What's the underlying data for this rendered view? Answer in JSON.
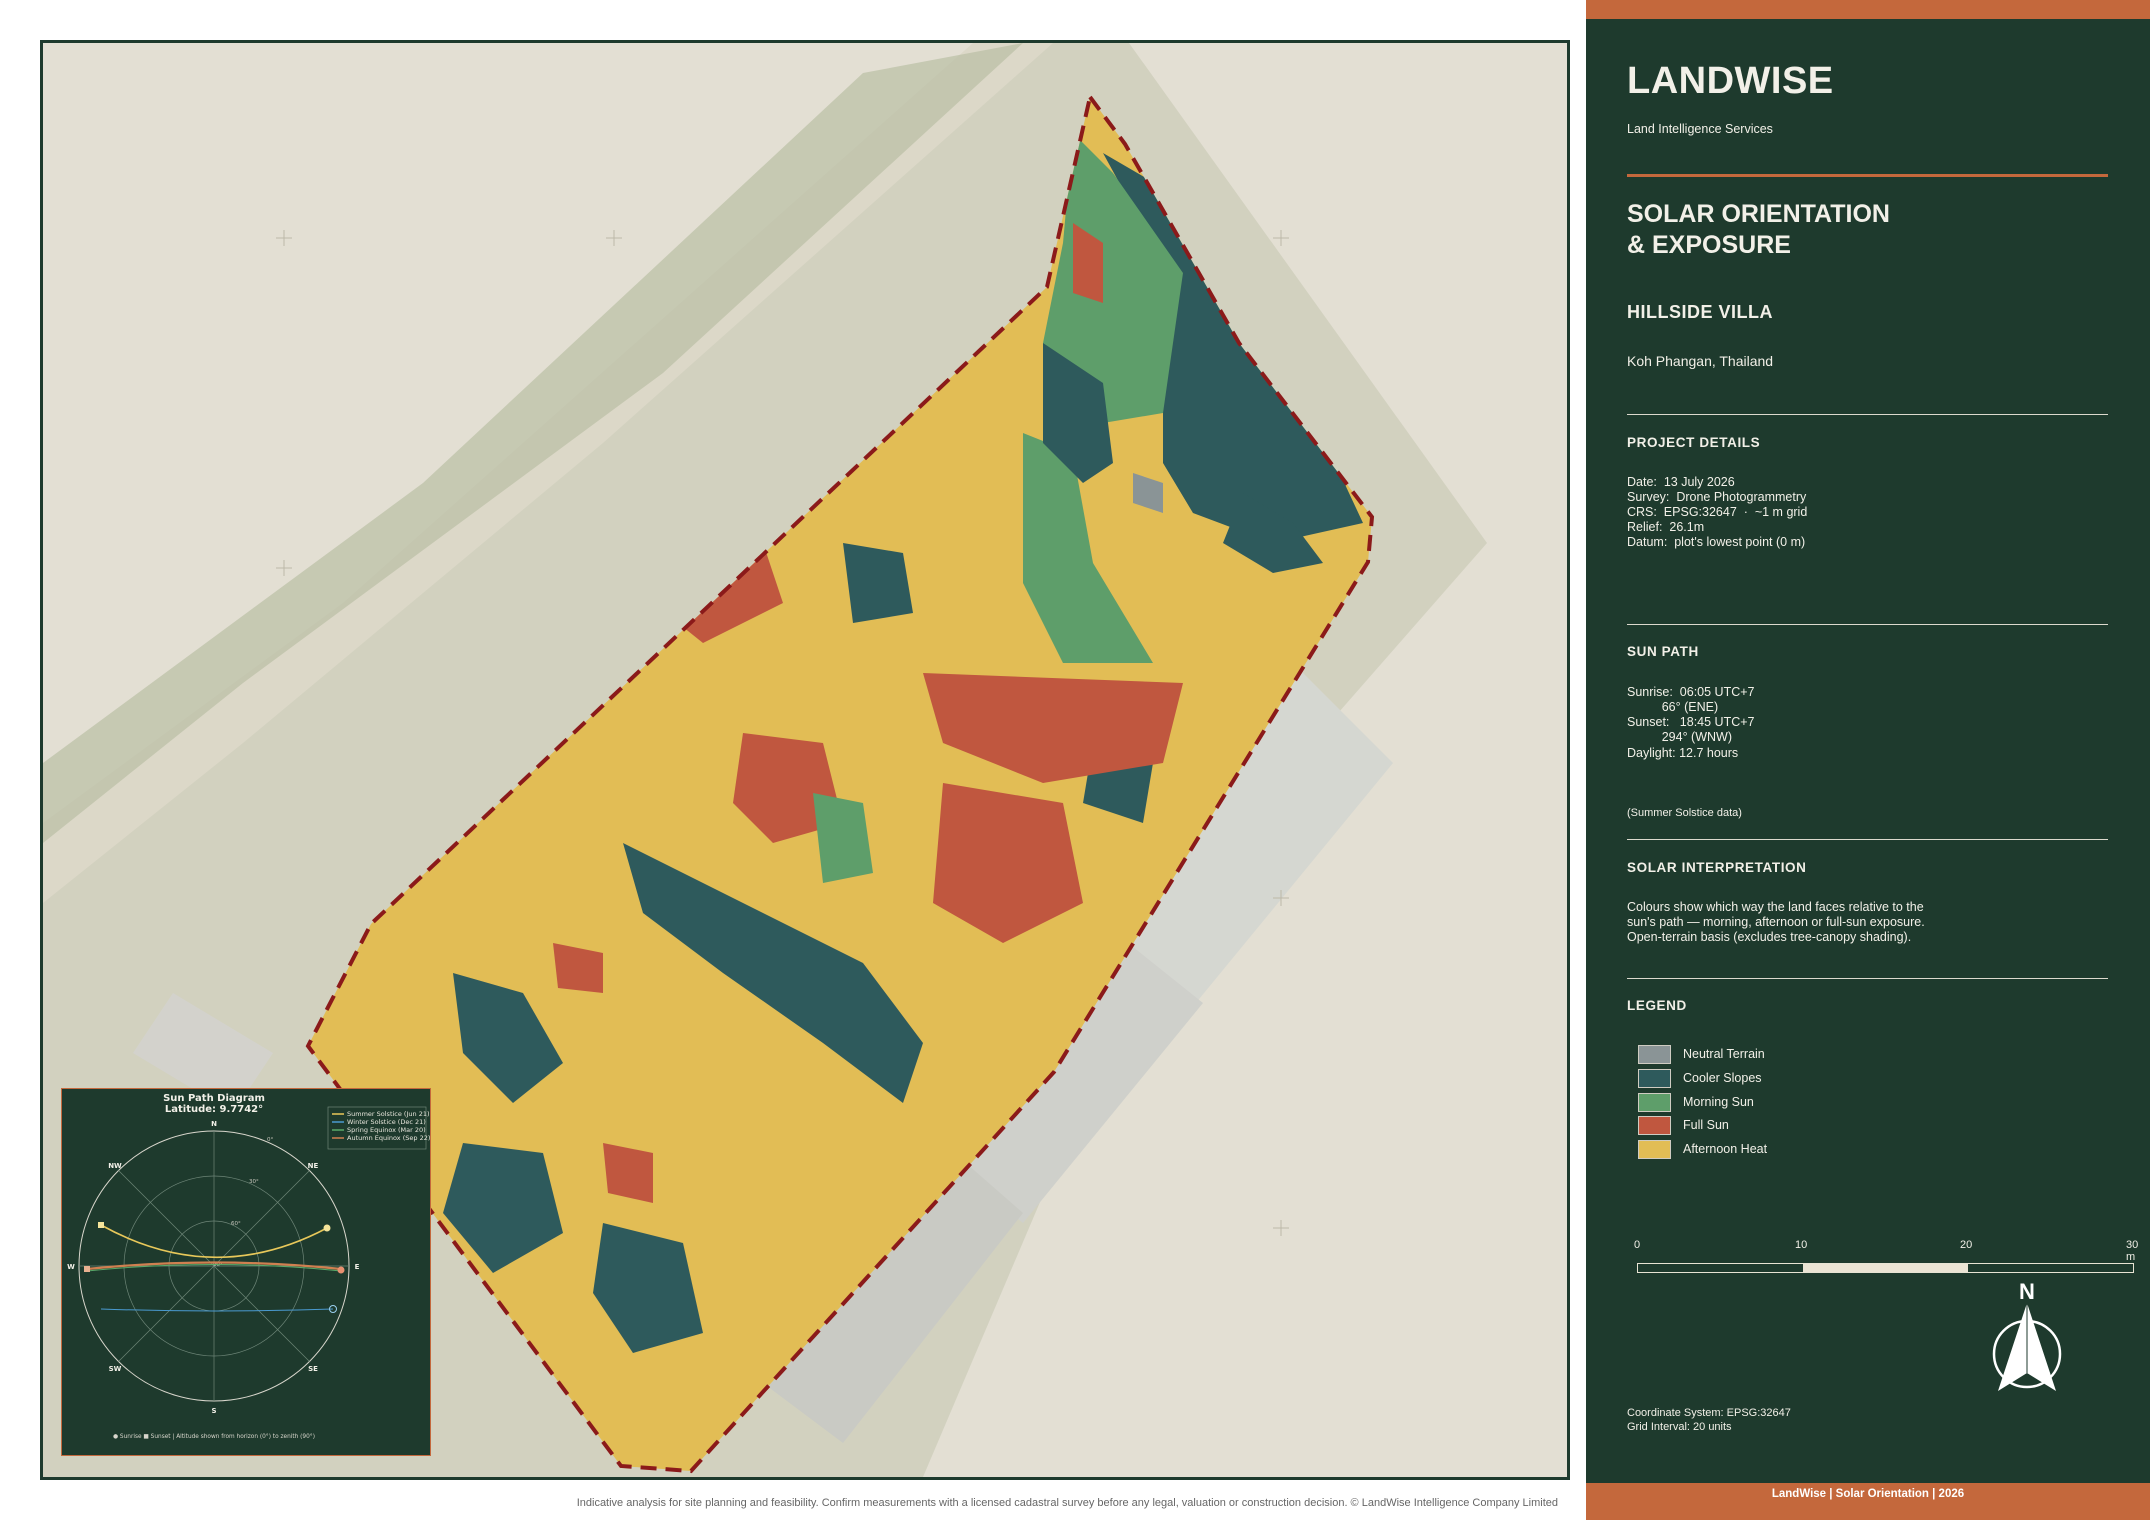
{
  "brand": {
    "name": "LANDWISE",
    "tagline": "Land Intelligence Services"
  },
  "report": {
    "title_line1": "SOLAR ORIENTATION",
    "title_line2": "& EXPOSURE",
    "project_name": "HILLSIDE VILLA",
    "location": "Koh Phangan, Thailand"
  },
  "project_details": {
    "heading": "PROJECT DETAILS",
    "lines": [
      "Date:  13 July 2026",
      "Survey:  Drone Photogrammetry",
      "CRS:  EPSG:32647  ·  ~1 m grid",
      "Relief:  26.1m",
      "Datum:  plot's lowest point (0 m)"
    ]
  },
  "sun_path": {
    "heading": "SUN PATH",
    "lines": [
      "Sunrise:  06:05 UTC+7",
      "          66° (ENE)",
      "Sunset:   18:45 UTC+7",
      "          294° (WNW)",
      "Daylight: 12.7 hours"
    ],
    "note": "(Summer Solstice data)"
  },
  "solar_interpretation": {
    "heading": "SOLAR INTERPRETATION",
    "lines": [
      "Colours show which way the land faces relative to the",
      "sun's path — morning, afternoon or full-sun exposure.",
      "Open-terrain basis (excludes tree-canopy shading)."
    ]
  },
  "legend": {
    "heading": "LEGEND",
    "items": [
      {
        "label": "Neutral Terrain",
        "color": "#8a9496"
      },
      {
        "label": "Cooler Slopes",
        "color": "#2e5a5c"
      },
      {
        "label": "Morning Sun",
        "color": "#5e9e6a"
      },
      {
        "label": "Full Sun",
        "color": "#c0573f"
      },
      {
        "label": "Afternoon Heat",
        "color": "#e5c05a"
      }
    ]
  },
  "scale_bar": {
    "labels": [
      "0",
      "10",
      "20",
      "30 m"
    ]
  },
  "north_arrow": {
    "label": "N"
  },
  "coordinate_info": [
    "Coordinate System: EPSG:32647",
    "Grid Interval: 20 units"
  ],
  "footer": "LandWise  |  Solar Orientation  |  2026",
  "disclaimer": "Indicative analysis for site planning and feasibility. Confirm measurements with a licensed cadastral survey before any legal, valuation or construction decision. © LandWise Intelligence Company Limited",
  "sun_diagram": {
    "title": "Sun Path Diagram",
    "latitude": "Latitude: 9.7742°",
    "directions": [
      "N",
      "NE",
      "E",
      "SE",
      "S",
      "SW",
      "W",
      "NW"
    ],
    "rings": [
      "0°",
      "30°",
      "60°",
      "90°"
    ],
    "legend": [
      {
        "label": "Summer Solstice (Jun 21)",
        "color": "#e8c85a"
      },
      {
        "label": "Winter Solstice (Dec 21)",
        "color": "#4a9ad0"
      },
      {
        "label": "Spring Equinox (Mar 20)",
        "color": "#5aaa6a"
      },
      {
        "label": "Autumn Equinox (Sep 22)",
        "color": "#d08050"
      }
    ],
    "caption": "● Sunrise  ■ Sunset | Altitude shown from horizon (0°) to zenith (90°)"
  },
  "colors": {
    "panel_bg": "#1e3a2d",
    "accent": "#c4683c",
    "plot_boundary": "#8b1a1a"
  }
}
